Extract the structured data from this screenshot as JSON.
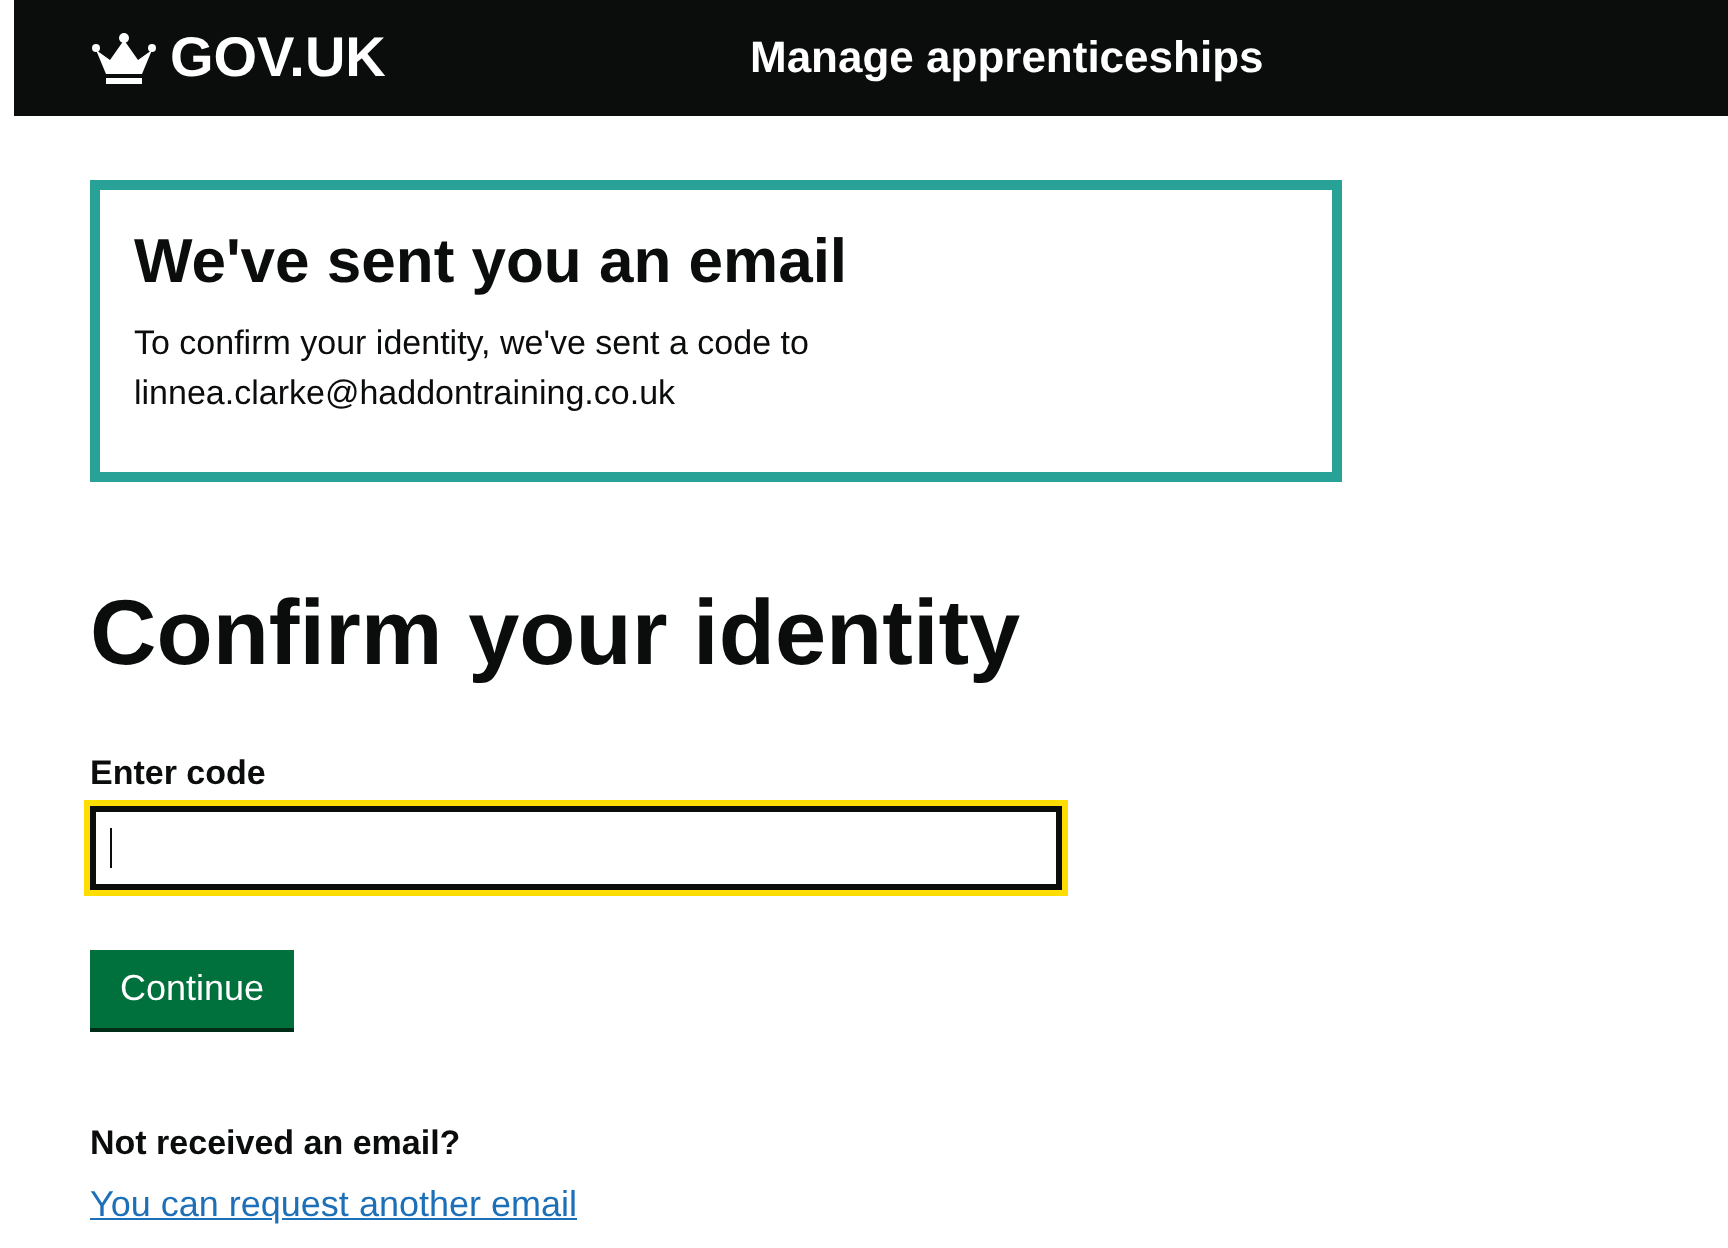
{
  "header": {
    "logo": "GOV.UK",
    "service": "Manage apprenticeships"
  },
  "notification": {
    "title": "We've sent you an email",
    "body": "To confirm your identity, we've sent a code to linnea.clarke@haddontraining.co.uk"
  },
  "heading": "Confirm your identity",
  "field": {
    "label": "Enter code",
    "focused": true
  },
  "button": "Continue",
  "help": {
    "heading": "Not received an email?",
    "link": "You can request another email"
  }
}
